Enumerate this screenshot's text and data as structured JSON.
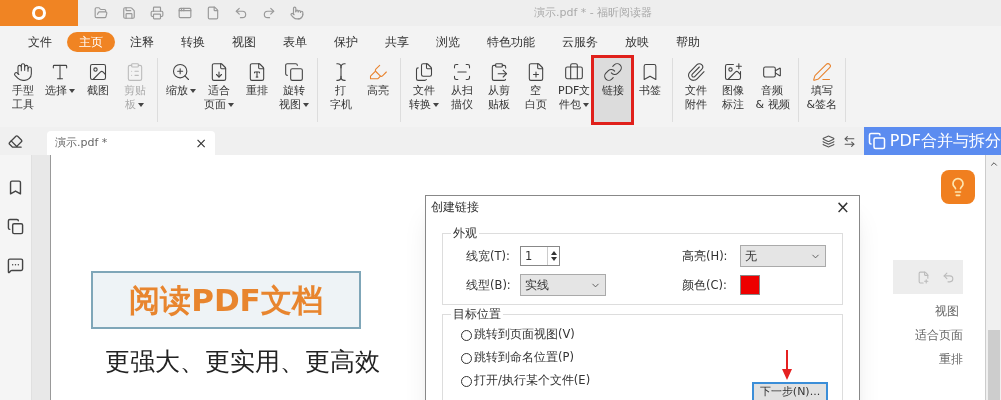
{
  "window": {
    "title": "演示.pdf * - 福昕阅读器"
  },
  "menu_tabs": [
    {
      "label": "文件",
      "selected": false
    },
    {
      "label": "主页",
      "selected": true
    },
    {
      "label": "注释",
      "selected": false
    },
    {
      "label": "转换",
      "selected": false
    },
    {
      "label": "视图",
      "selected": false
    },
    {
      "label": "表单",
      "selected": false
    },
    {
      "label": "保护",
      "selected": false
    },
    {
      "label": "共享",
      "selected": false
    },
    {
      "label": "浏览",
      "selected": false
    },
    {
      "label": "特色功能",
      "selected": false
    },
    {
      "label": "云服务",
      "selected": false
    },
    {
      "label": "放映",
      "selected": false
    },
    {
      "label": "帮助",
      "selected": false
    }
  ],
  "ribbon_groups": [
    [
      {
        "lines": [
          "手型",
          "工具"
        ],
        "dropdown": false,
        "disabled": false,
        "selected": false
      },
      {
        "lines": [
          "选择"
        ],
        "dropdown": true,
        "disabled": false,
        "selected": false
      },
      {
        "lines": [
          "截图"
        ],
        "dropdown": false,
        "disabled": false,
        "selected": false
      },
      {
        "lines": [
          "剪贴",
          "板"
        ],
        "dropdown": true,
        "disabled": true,
        "selected": false
      }
    ],
    [
      {
        "lines": [
          "缩放"
        ],
        "dropdown": true,
        "disabled": false,
        "selected": false
      },
      {
        "lines": [
          "适合",
          "页面"
        ],
        "dropdown": true,
        "disabled": false,
        "selected": false
      },
      {
        "lines": [
          "重排"
        ],
        "dropdown": false,
        "disabled": false,
        "selected": false
      },
      {
        "lines": [
          "旋转",
          "视图"
        ],
        "dropdown": true,
        "disabled": false,
        "selected": false
      }
    ],
    [
      {
        "lines": [
          "打",
          "字机"
        ],
        "dropdown": false,
        "disabled": false,
        "selected": false
      },
      {
        "lines": [
          "高亮"
        ],
        "dropdown": false,
        "disabled": false,
        "selected": false
      }
    ],
    [
      {
        "lines": [
          "文件",
          "转换"
        ],
        "dropdown": true,
        "disabled": false,
        "selected": false
      },
      {
        "lines": [
          "从扫",
          "描仪"
        ],
        "dropdown": false,
        "disabled": false,
        "selected": false
      },
      {
        "lines": [
          "从剪",
          "贴板"
        ],
        "dropdown": false,
        "disabled": false,
        "selected": false
      },
      {
        "lines": [
          "空",
          "白页"
        ],
        "dropdown": false,
        "disabled": false,
        "selected": false
      },
      {
        "lines": [
          "PDF文",
          "件包"
        ],
        "dropdown": true,
        "disabled": false,
        "selected": false
      },
      {
        "lines": [
          "链接"
        ],
        "dropdown": false,
        "disabled": false,
        "selected": true
      },
      {
        "lines": [
          "书签"
        ],
        "dropdown": false,
        "disabled": false,
        "selected": false
      }
    ],
    [
      {
        "lines": [
          "文件",
          "附件"
        ],
        "dropdown": false,
        "disabled": false,
        "selected": false
      },
      {
        "lines": [
          "图像",
          "标注"
        ],
        "dropdown": false,
        "disabled": false,
        "selected": false
      },
      {
        "lines": [
          "音频",
          "& 视频"
        ],
        "dropdown": false,
        "disabled": false,
        "selected": false
      }
    ],
    [
      {
        "lines": [
          "填写",
          "&签名"
        ],
        "dropdown": false,
        "disabled": false,
        "selected": false
      }
    ]
  ],
  "document_tab": {
    "label": "演示.pdf *",
    "close": "×"
  },
  "banner": {
    "label": "PDF合并与拆分"
  },
  "page": {
    "heading": "阅读PDF文档",
    "subheading": "更强大、更实用、更高效",
    "snippet": {
      "title": "视图",
      "items": [
        "适合页面",
        "重排"
      ]
    }
  },
  "dialog": {
    "title": "创建链接",
    "close": "×",
    "appearance": {
      "legend": "外观",
      "line_width": {
        "label": "线宽(T):",
        "value": "1"
      },
      "highlight": {
        "label": "高亮(H):",
        "value": "无"
      },
      "line_style": {
        "label": "线型(B):",
        "value": "实线"
      },
      "color": {
        "label": "颜色(C):",
        "color": "#ee0000"
      }
    },
    "target": {
      "legend": "目标位置",
      "options": [
        {
          "label": "跳转到页面视图(V)",
          "selected": false
        },
        {
          "label": "跳转到命名位置(P)",
          "selected": false
        },
        {
          "label": "打开/执行某个文件(E)",
          "selected": false
        }
      ]
    },
    "next_button": "下一步(N)..."
  }
}
